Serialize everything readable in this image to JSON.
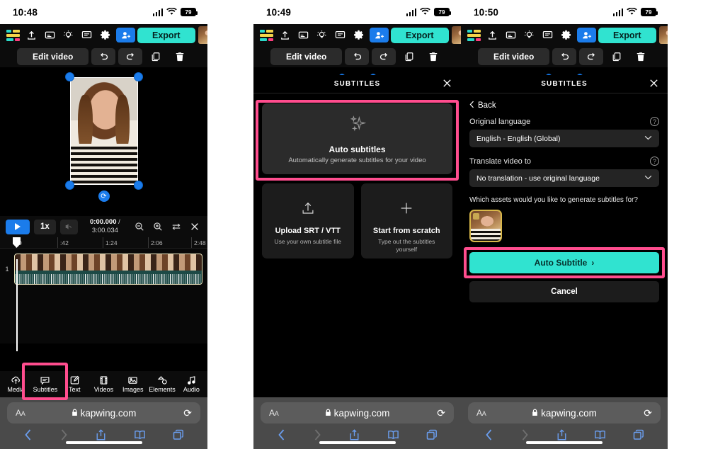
{
  "panels": [
    {
      "status": {
        "time": "10:48",
        "battery": "79"
      },
      "toolbar": {
        "logo": "kapwing-logo",
        "icons": [
          "upload-icon",
          "caption-icon",
          "magic-idea-icon",
          "comment-icon",
          "settings-gear-icon"
        ],
        "invite_icon": "add-person-icon",
        "export_label": "Export",
        "avatar": "user-avatar"
      },
      "edit_row": {
        "edit_video_label": "Edit video",
        "undo_icon": "undo-icon",
        "redo_icon": "redo-icon",
        "duplicate_icon": "duplicate-icon",
        "delete_icon": "trash-icon"
      },
      "player": {
        "play_icon": "play-icon",
        "speed_label": "1x",
        "mute_icon": "mute-icon",
        "current_time": "0:00.000",
        "separator": "/",
        "total_time": "3:00.034",
        "zoom_out_icon": "zoom-out-icon",
        "zoom_in_icon": "zoom-in-icon",
        "fit_icon": "fit-timeline-icon",
        "close_icon": "close-icon"
      },
      "timeline": {
        "ticks": [
          "0",
          ":42",
          "1:24",
          "2:06",
          "2:48"
        ],
        "track_number": "1"
      },
      "tabs": [
        {
          "label": "Media",
          "icon": "media-upload-icon",
          "highlighted": false
        },
        {
          "label": "Subtitles",
          "icon": "subtitles-icon",
          "highlighted": true
        },
        {
          "label": "Text",
          "icon": "text-icon",
          "highlighted": false
        },
        {
          "label": "Videos",
          "icon": "videos-icon",
          "highlighted": false
        },
        {
          "label": "Images",
          "icon": "images-icon",
          "highlighted": false
        },
        {
          "label": "Elements",
          "icon": "elements-icon",
          "highlighted": false
        },
        {
          "label": "Audio",
          "icon": "audio-icon",
          "highlighted": false
        }
      ],
      "safari": {
        "aa_label": "AA",
        "lock_icon": "lock-icon",
        "host": "kapwing.com",
        "reload_icon": "reload-icon",
        "back_icon": "back-chevron-icon",
        "forward_icon": "forward-chevron-icon",
        "share_icon": "share-icon",
        "bookmarks_icon": "book-icon",
        "tabs_icon": "tabs-icon"
      }
    },
    {
      "status": {
        "time": "10:49",
        "battery": "79"
      },
      "modal": {
        "title": "SUBTITLES",
        "close_icon": "close-icon",
        "auto": {
          "icon": "sparkle-icon",
          "title": "Auto subtitles",
          "subtitle": "Automatically generate subtitles for your video",
          "highlighted": true
        },
        "options": [
          {
            "icon": "upload-arrow-icon",
            "title": "Upload SRT / VTT",
            "subtitle": "Use your own subtitle file"
          },
          {
            "icon": "plus-icon",
            "title": "Start from scratch",
            "subtitle": "Type out the subtitles yourself"
          }
        ]
      }
    },
    {
      "status": {
        "time": "10:50",
        "battery": "79"
      },
      "modal": {
        "title": "SUBTITLES",
        "close_icon": "close-icon",
        "back_label": "Back",
        "back_icon": "back-chevron-icon",
        "original_language_label": "Original language",
        "original_language_value": "English - English (Global)",
        "translate_label": "Translate video to",
        "translate_value": "No translation - use original language",
        "assets_question": "Which assets would you like to generate subtitles for?",
        "auto_subtitle_label": "Auto Subtitle",
        "auto_subtitle_chevron": "›",
        "cancel_label": "Cancel",
        "highlighted": true
      }
    }
  ],
  "colors": {
    "accent_teal": "#30e3d0",
    "accent_blue": "#1b7ceb",
    "highlight_pink": "#ff4d8e",
    "panel_bg": "#000000",
    "safari_bg": "#4a4a4a"
  }
}
